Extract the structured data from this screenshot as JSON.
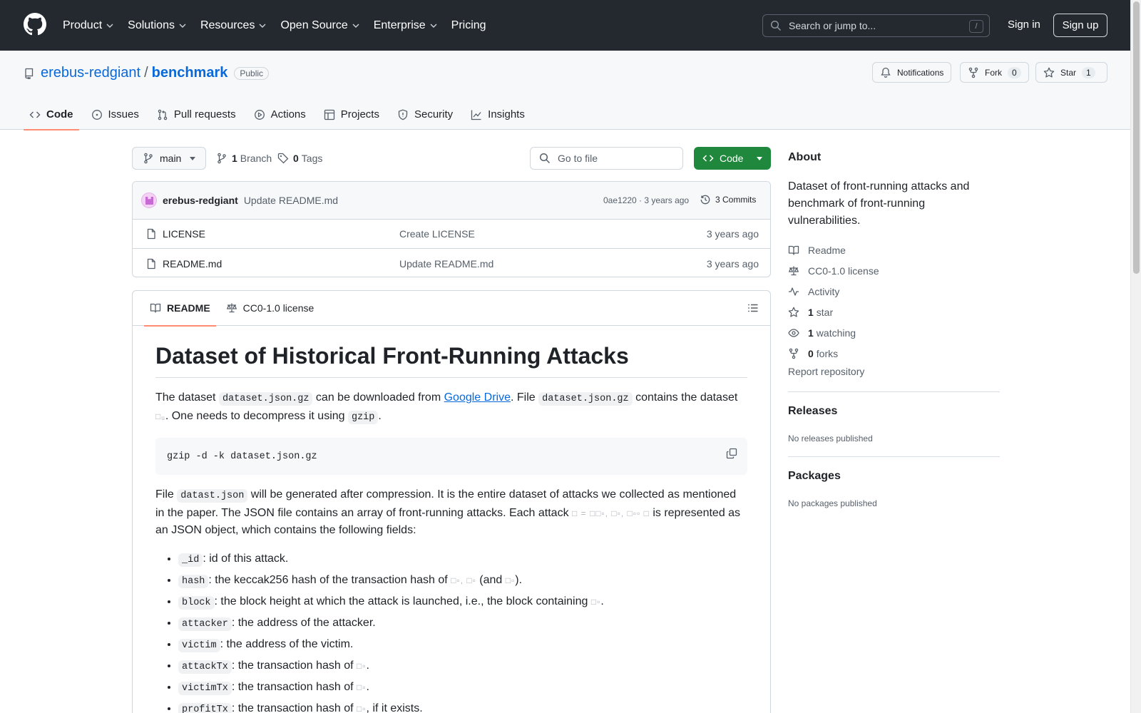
{
  "header": {
    "nav": [
      {
        "label": "Product",
        "has_menu": true
      },
      {
        "label": "Solutions",
        "has_menu": true
      },
      {
        "label": "Resources",
        "has_menu": true
      },
      {
        "label": "Open Source",
        "has_menu": true
      },
      {
        "label": "Enterprise",
        "has_menu": true
      },
      {
        "label": "Pricing",
        "has_menu": false
      }
    ],
    "search_placeholder": "Search or jump to...",
    "search_shortcut": "/",
    "sign_in": "Sign in",
    "sign_up": "Sign up"
  },
  "repo": {
    "owner": "erebus-redgiant",
    "separator": "/",
    "name": "benchmark",
    "visibility": "Public",
    "notifications_label": "Notifications",
    "fork_label": "Fork",
    "fork_count": "0",
    "star_label": "Star",
    "star_count": "1",
    "tabs": [
      {
        "label": "Code",
        "icon": "code-icon",
        "active": true
      },
      {
        "label": "Issues",
        "icon": "issue-icon"
      },
      {
        "label": "Pull requests",
        "icon": "pull-request-icon"
      },
      {
        "label": "Actions",
        "icon": "play-icon"
      },
      {
        "label": "Projects",
        "icon": "table-icon"
      },
      {
        "label": "Security",
        "icon": "shield-icon"
      },
      {
        "label": "Insights",
        "icon": "graph-icon"
      }
    ]
  },
  "browser": {
    "branch": "main",
    "branch_count": "1",
    "branch_label": "Branch",
    "tag_count": "0",
    "tag_label": "Tags",
    "go_to_file": "Go to file",
    "code_button": "Code",
    "latest_commit": {
      "author": "erebus-redgiant",
      "message": "Update README.md",
      "hash_time": "0ae1220 · 3 years ago",
      "commits": "3 Commits"
    },
    "files": [
      {
        "name": "LICENSE",
        "message": "Create LICENSE",
        "date": "3 years ago"
      },
      {
        "name": "README.md",
        "message": "Update README.md",
        "date": "3 years ago"
      }
    ]
  },
  "readme": {
    "tabs": [
      {
        "label": "README",
        "icon": "book-icon",
        "active": true
      },
      {
        "label": "CC0-1.0 license",
        "icon": "law-icon"
      }
    ],
    "title": "Dataset of Historical Front-Running Attacks",
    "p1": {
      "t1": "The dataset ",
      "c1": "dataset.json.gz",
      "t2": " can be downloaded from ",
      "link": "Google Drive",
      "t3": ". File ",
      "c2": "dataset.json.gz",
      "t4": " contains the dataset ",
      "m1": "□ᵤ",
      "t5": ". One needs to decompress it using ",
      "c3": "gzip",
      "t6": "."
    },
    "code_block": "gzip -d -k dataset.json.gz",
    "p2": {
      "t1": "File ",
      "c1": "datast.json",
      "t2": " will be generated after compression. It is the entire dataset of attacks we collected as mentioned in the paper. The JSON file contains an array of front-running attacks. Each attack ",
      "m1": "□ = □□▫, □▫, □▫▫ □",
      "t3": " is represented as an JSON object, which contains the following fields:"
    },
    "fields": [
      {
        "key": "_id",
        "desc": ": id of this attack."
      },
      {
        "key": "hash",
        "desc": ": the keccak256 hash of the transaction hash of ",
        "math": "□▫, □▫",
        "tail": " (and ",
        "math2": "□▫",
        "tail2": ")."
      },
      {
        "key": "block",
        "desc": ": the block height at which the attack is launched, i.e., the block containing ",
        "math": "□▫",
        "tail": "."
      },
      {
        "key": "attacker",
        "desc": ": the address of the attacker."
      },
      {
        "key": "victim",
        "desc": ": the address of the victim."
      },
      {
        "key": "attackTx",
        "desc": ": the transaction hash of ",
        "math": "□▫",
        "tail": "."
      },
      {
        "key": "victimTx",
        "desc": ": the transaction hash of ",
        "math": "□▫",
        "tail": "."
      },
      {
        "key": "profitTx",
        "desc": ": the transaction hash of ",
        "math": "□▫",
        "tail": ", if it exists."
      }
    ]
  },
  "sidebar": {
    "about_title": "About",
    "description": "Dataset of front-running attacks and benchmark of front-running vulnerabilities.",
    "items": [
      {
        "icon": "book-icon",
        "bold": "",
        "label": "Readme"
      },
      {
        "icon": "law-icon",
        "bold": "",
        "label": "CC0-1.0 license"
      },
      {
        "icon": "pulse-icon",
        "bold": "",
        "label": "Activity"
      },
      {
        "icon": "star-icon",
        "bold": "1",
        "label": "star"
      },
      {
        "icon": "eye-icon",
        "bold": "1",
        "label": "watching"
      },
      {
        "icon": "fork-icon",
        "bold": "0",
        "label": "forks"
      }
    ],
    "report": "Report repository",
    "releases_title": "Releases",
    "releases_text": "No releases published",
    "packages_title": "Packages",
    "packages_text": "No packages published"
  },
  "colors": {
    "header_bg": "#24292f",
    "link": "#0969da",
    "primary_button": "#1f883d",
    "active_tab_underline": "#fd8c73"
  }
}
